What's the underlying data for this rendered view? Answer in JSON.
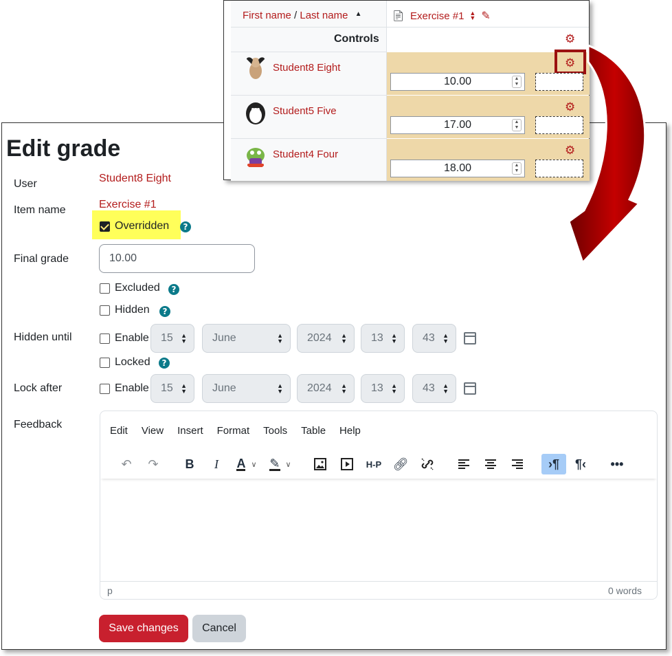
{
  "grader": {
    "header_first": "First name",
    "header_sep": " / ",
    "header_last": "Last name",
    "sort_icon": "sort-asc-icon",
    "item_name": "Exercise #1",
    "controls_label": "Controls",
    "students": [
      {
        "name": "Student8 Eight",
        "grade": "10.00"
      },
      {
        "name": "Student5 Five",
        "grade": "17.00"
      },
      {
        "name": "Student4 Four",
        "grade": "18.00"
      }
    ],
    "highlight_color": "#b31c1c"
  },
  "form": {
    "title": "Edit grade",
    "user_label": "User",
    "user_value": "Student8 Eight",
    "item_label": "Item name",
    "item_value": "Exercise #1",
    "overridden_label": "Overridden",
    "final_grade_label": "Final grade",
    "final_grade_value": "10.00",
    "excluded_label": "Excluded",
    "hidden_label": "Hidden",
    "hidden_until_label": "Hidden until",
    "enable_label": "Enable",
    "locked_label": "Locked",
    "lock_after_label": "Lock after",
    "feedback_label": "Feedback",
    "date": {
      "day": "15",
      "month": "June",
      "year": "2024",
      "hour": "13",
      "minute": "43"
    }
  },
  "editor": {
    "menu": [
      "Edit",
      "View",
      "Insert",
      "Format",
      "Tools",
      "Table",
      "Help"
    ],
    "path": "p",
    "word_count": "0 words"
  },
  "buttons": {
    "save": "Save changes",
    "cancel": "Cancel"
  },
  "colors": {
    "accent": "#c8202e",
    "help": "#0b7a8a",
    "highlight": "#ffff5a",
    "grade_cell": "#eed8a9"
  }
}
